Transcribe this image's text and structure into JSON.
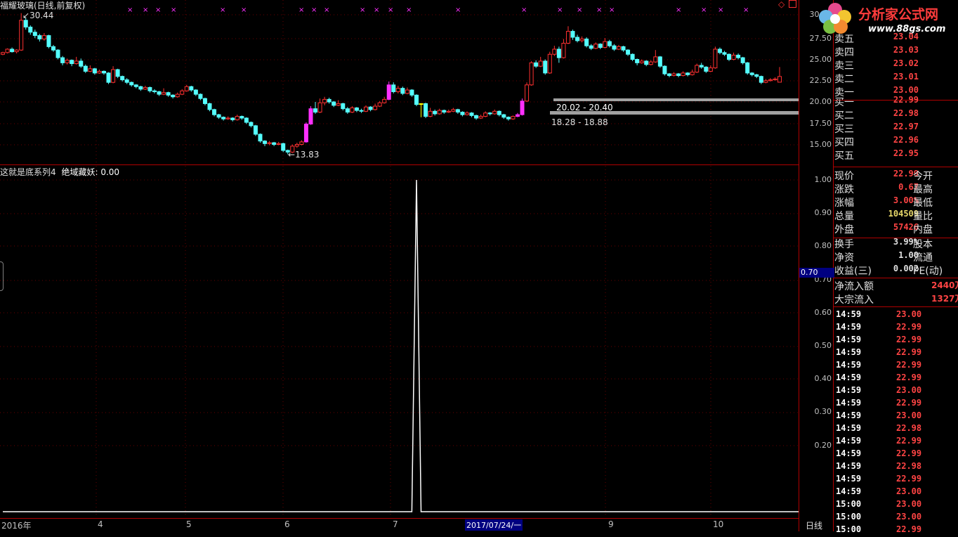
{
  "chart_title": "福耀玻璃(日线,前复权)",
  "indicator_title": "这就是底系列4",
  "indicator_name": "绝域藏妖",
  "indicator_value": "0.00",
  "price_axis": [
    "30.00",
    "27.50",
    "25.00",
    "22.50",
    "20.00",
    "17.50",
    "15.00"
  ],
  "indicator_axis": [
    "1.00",
    "0.90",
    "0.80",
    "0.70",
    "0.60",
    "0.50",
    "0.40",
    "0.30",
    "0.20"
  ],
  "indicator_cursor_value": "0.70",
  "annotations": {
    "high": "30.44",
    "low": "13.83",
    "zone_upper": "20.02 - 20.40",
    "zone_lower": "18.28 - 18.88"
  },
  "date_labels": [
    "2016年",
    "4",
    "5",
    "6",
    "7",
    "9",
    "10"
  ],
  "cursor_date": "2017/07/24/一",
  "period_tab": "日线",
  "logo": {
    "name": "分析家公式网",
    "url": "www.88gs.com"
  },
  "order_book": {
    "asks": [
      {
        "label": "卖五",
        "price": "23.04"
      },
      {
        "label": "卖四",
        "price": "23.03"
      },
      {
        "label": "卖三",
        "price": "23.02"
      },
      {
        "label": "卖二",
        "price": "23.01"
      },
      {
        "label": "卖一",
        "price": "23.00"
      }
    ],
    "bids": [
      {
        "label": "买一",
        "price": "22.99"
      },
      {
        "label": "买二",
        "price": "22.98"
      },
      {
        "label": "买三",
        "price": "22.97"
      },
      {
        "label": "买四",
        "price": "22.96"
      },
      {
        "label": "买五",
        "price": "22.95"
      }
    ]
  },
  "quote": [
    {
      "k": "现价",
      "v": "22.99",
      "k2": "今开",
      "color": "#ff4444"
    },
    {
      "k": "涨跌",
      "v": "0.67",
      "k2": "最高",
      "color": "#ff4444"
    },
    {
      "k": "涨幅",
      "v": "3.00%",
      "k2": "最低",
      "color": "#ff4444"
    },
    {
      "k": "总量",
      "v": "104509",
      "k2": "量比",
      "color": "#e8d86a"
    },
    {
      "k": "外盘",
      "v": "57426",
      "k2": "内盘",
      "color": "#ff4444"
    }
  ],
  "quote2": [
    {
      "k": "换手",
      "v": "3.99%",
      "k2": "股本",
      "color": "#e0e0e0"
    },
    {
      "k": "净资",
      "v": "1.00",
      "k2": "流通",
      "color": "#e0e0e0"
    },
    {
      "k": "收益(三)",
      "v": "0.002",
      "k2": "PE(动)",
      "color": "#e0e0e0"
    }
  ],
  "flows": [
    {
      "k": "净流入额",
      "v": "2440万"
    },
    {
      "k": "大宗流入",
      "v": "1327万"
    }
  ],
  "ticks": [
    {
      "t": "14:59",
      "p": "23.00"
    },
    {
      "t": "14:59",
      "p": "22.99"
    },
    {
      "t": "14:59",
      "p": "22.99"
    },
    {
      "t": "14:59",
      "p": "22.99"
    },
    {
      "t": "14:59",
      "p": "22.99"
    },
    {
      "t": "14:59",
      "p": "22.99"
    },
    {
      "t": "14:59",
      "p": "23.00"
    },
    {
      "t": "14:59",
      "p": "22.99"
    },
    {
      "t": "14:59",
      "p": "23.00"
    },
    {
      "t": "14:59",
      "p": "22.98"
    },
    {
      "t": "14:59",
      "p": "22.99"
    },
    {
      "t": "14:59",
      "p": "22.99"
    },
    {
      "t": "14:59",
      "p": "22.98"
    },
    {
      "t": "14:59",
      "p": "22.99"
    },
    {
      "t": "14:59",
      "p": "23.00"
    },
    {
      "t": "15:00",
      "p": "23.00"
    },
    {
      "t": "15:00",
      "p": "23.00"
    },
    {
      "t": "15:00",
      "p": "22.99"
    }
  ],
  "colors": {
    "up": "#ff3030",
    "down": "#54ffff",
    "grid": "#8b0000",
    "special_up": "#ff30ff",
    "special_flat": "#ffff00"
  },
  "chart_data": {
    "type": "line",
    "series": [
      {
        "values": [
          0,
          0,
          0,
          0,
          0,
          0,
          0,
          0,
          0,
          0,
          0,
          0,
          0,
          0,
          0,
          0,
          0,
          0,
          0,
          0,
          0,
          0,
          0,
          0,
          0,
          0,
          0,
          0,
          0,
          0,
          0,
          0,
          0,
          0,
          0,
          0,
          0,
          0,
          0,
          0,
          0,
          0,
          0,
          0,
          0,
          0,
          0,
          0,
          0,
          0,
          0,
          0,
          0,
          0,
          0,
          0,
          0,
          0,
          0,
          0,
          0,
          0,
          0,
          0,
          0,
          0,
          0,
          0,
          0,
          0,
          0,
          0,
          0,
          0,
          0,
          0,
          0,
          0,
          0,
          0,
          0,
          0,
          0,
          0,
          0,
          0,
          0,
          0,
          0,
          0,
          1,
          0,
          0,
          0,
          0,
          0,
          0,
          0,
          0,
          0,
          0,
          0,
          0,
          0,
          0,
          0,
          0,
          0,
          0,
          0,
          0,
          0,
          0,
          0,
          0,
          0,
          0,
          0,
          0,
          0,
          0,
          0,
          0,
          0,
          0,
          0,
          0,
          0,
          0,
          0,
          0,
          0,
          0,
          0,
          0,
          0,
          0,
          0,
          0,
          0,
          0,
          0,
          0,
          0,
          0,
          0,
          0,
          0,
          0,
          0,
          0,
          0,
          0,
          0,
          0,
          0,
          0,
          0,
          0,
          0,
          0,
          0,
          0,
          0,
          0,
          0,
          0,
          0,
          0,
          0,
          0,
          0,
          0,
          0,
          0,
          0,
          0,
          0,
          0,
          0,
          0,
          0,
          0,
          0,
          0,
          0,
          0,
          0,
          0,
          0,
          0,
          0,
          0,
          0,
          0,
          0,
          0,
          0,
          0,
          0,
          0,
          0,
          0,
          0,
          0,
          0,
          0,
          0,
          0,
          0,
          0,
          0,
          0,
          0,
          0,
          0,
          0,
          0,
          0,
          0,
          0,
          0,
          0,
          0,
          0,
          0,
          0,
          0,
          0,
          0,
          0,
          0,
          0,
          0,
          0,
          0,
          0,
          0,
          0,
          0,
          0,
          0,
          0,
          0,
          0,
          0,
          0,
          0,
          0,
          0,
          0,
          0,
          0,
          0,
          0,
          0,
          0,
          0,
          0,
          0,
          0,
          0,
          0,
          0,
          0
        ]
      }
    ],
    "ylim": [
      0,
      1
    ],
    "ticks_y": [
      0.2,
      0.3,
      0.4,
      0.5,
      0.6,
      0.7,
      0.8,
      0.9,
      1.0
    ]
  },
  "candles": [
    [
      25.6,
      25.8,
      25.9,
      25.5
    ],
    [
      25.8,
      26.2,
      26.3,
      25.7
    ],
    [
      26.2,
      25.9,
      26.4,
      25.8
    ],
    [
      25.9,
      26.1,
      26.2,
      25.7
    ],
    [
      26.1,
      29.6,
      30.44,
      26.0
    ],
    [
      29.6,
      28.8,
      29.9,
      28.5
    ],
    [
      28.8,
      28.2,
      29.0,
      27.9
    ],
    [
      28.2,
      27.8,
      28.5,
      27.5
    ],
    [
      27.8,
      27.4,
      28.0,
      27.1
    ],
    [
      27.4,
      27.8,
      28.1,
      27.2
    ],
    [
      27.8,
      26.5,
      27.9,
      26.3
    ],
    [
      26.5,
      26.1,
      26.7,
      25.9
    ],
    [
      26.1,
      25.2,
      26.2,
      25.0
    ],
    [
      25.2,
      24.6,
      25.4,
      24.3
    ],
    [
      24.6,
      24.9,
      25.1,
      24.4
    ],
    [
      24.9,
      24.5,
      25.0,
      24.2
    ],
    [
      24.5,
      24.8,
      25.3,
      24.4
    ],
    [
      24.8,
      24.2,
      25.1,
      24.0
    ],
    [
      24.2,
      23.6,
      24.4,
      23.4
    ],
    [
      23.6,
      23.9,
      24.3,
      23.5
    ],
    [
      23.9,
      23.4,
      24.0,
      23.2
    ],
    [
      23.4,
      23.6,
      23.8,
      23.3
    ],
    [
      23.6,
      23.4,
      23.7,
      23.2
    ],
    [
      23.4,
      22.3,
      23.5,
      22.1
    ],
    [
      22.3,
      23.8,
      24.2,
      22.2
    ],
    [
      23.8,
      23.0,
      23.9,
      22.8
    ],
    [
      23.0,
      22.6,
      23.1,
      22.4
    ],
    [
      22.6,
      22.3,
      22.8,
      22.1
    ],
    [
      22.3,
      22.0,
      22.4,
      21.8
    ],
    [
      22.0,
      21.8,
      22.1,
      21.6
    ],
    [
      21.8,
      21.5,
      21.9,
      21.3
    ],
    [
      21.5,
      21.7,
      21.9,
      21.4
    ],
    [
      21.7,
      21.3,
      21.8,
      21.1
    ],
    [
      21.3,
      21.2,
      21.5,
      21.0
    ],
    [
      21.2,
      20.9,
      21.3,
      20.7
    ],
    [
      20.9,
      21.1,
      21.6,
      20.8
    ],
    [
      21.1,
      20.8,
      21.2,
      20.6
    ],
    [
      20.8,
      20.6,
      20.9,
      20.4
    ],
    [
      20.6,
      20.9,
      21.1,
      20.5
    ],
    [
      20.9,
      21.3,
      21.5,
      20.8
    ],
    [
      21.3,
      21.8,
      22.0,
      21.2
    ],
    [
      21.8,
      21.4,
      21.9,
      21.2
    ],
    [
      21.4,
      20.9,
      21.5,
      20.7
    ],
    [
      20.9,
      20.4,
      21.0,
      20.2
    ],
    [
      20.4,
      19.8,
      20.5,
      19.6
    ],
    [
      19.8,
      19.1,
      19.9,
      18.9
    ],
    [
      19.1,
      18.5,
      19.2,
      18.3
    ],
    [
      18.5,
      18.2,
      18.6,
      18.0
    ],
    [
      18.2,
      18.0,
      18.3,
      17.8
    ],
    [
      18.0,
      18.1,
      18.3,
      17.9
    ],
    [
      18.1,
      17.9,
      18.2,
      17.7
    ],
    [
      17.9,
      18.3,
      18.5,
      17.8
    ],
    [
      18.3,
      18.1,
      18.4,
      17.9
    ],
    [
      18.1,
      17.6,
      18.2,
      17.4
    ],
    [
      17.6,
      17.2,
      17.7,
      17.0
    ],
    [
      17.2,
      16.2,
      17.3,
      16.0
    ],
    [
      16.2,
      15.4,
      16.3,
      15.2
    ],
    [
      15.4,
      15.1,
      15.5,
      14.8
    ],
    [
      15.1,
      15.2,
      15.4,
      14.9
    ],
    [
      15.2,
      15.0,
      15.3,
      14.8
    ],
    [
      15.0,
      15.1,
      15.3,
      14.9
    ],
    [
      15.1,
      14.3,
      15.2,
      14.1
    ],
    [
      14.3,
      14.1,
      14.4,
      13.83
    ],
    [
      14.1,
      14.8,
      15.0,
      14.0
    ],
    [
      14.8,
      15.0,
      15.2,
      14.6
    ],
    [
      15.0,
      15.3,
      15.5,
      14.9
    ],
    [
      15.3,
      17.4,
      17.6,
      15.2
    ],
    [
      17.4,
      19.2,
      19.5,
      17.3
    ],
    [
      19.2,
      18.8,
      20.0,
      18.6
    ],
    [
      18.8,
      19.9,
      20.4,
      18.7
    ],
    [
      19.9,
      20.3,
      20.6,
      19.6
    ],
    [
      20.3,
      20.0,
      20.5,
      19.8
    ],
    [
      20.0,
      19.6,
      20.1,
      19.4
    ],
    [
      19.6,
      19.8,
      20.2,
      19.5
    ],
    [
      19.8,
      19.2,
      19.9,
      19.0
    ],
    [
      19.2,
      18.8,
      19.4,
      18.6
    ],
    [
      18.8,
      19.3,
      19.5,
      18.7
    ],
    [
      19.3,
      19.0,
      19.4,
      18.8
    ],
    [
      19.0,
      18.9,
      19.2,
      18.7
    ],
    [
      18.9,
      19.4,
      19.6,
      18.8
    ],
    [
      19.4,
      19.1,
      19.5,
      18.9
    ],
    [
      19.1,
      19.5,
      19.8,
      19.0
    ],
    [
      19.5,
      19.9,
      20.1,
      19.4
    ],
    [
      19.9,
      20.3,
      20.6,
      19.8
    ],
    [
      20.3,
      22.0,
      22.4,
      20.2
    ],
    [
      22.0,
      21.2,
      22.3,
      21.0
    ],
    [
      21.2,
      21.6,
      21.9,
      21.0
    ],
    [
      21.6,
      21.0,
      21.8,
      20.8
    ],
    [
      21.0,
      21.4,
      21.7,
      20.9
    ],
    [
      21.4,
      20.8,
      21.5,
      20.6
    ],
    [
      20.8,
      19.7,
      20.9,
      19.5
    ],
    [
      19.7,
      19.8,
      19.8,
      18.2
    ],
    [
      19.8,
      18.3,
      19.9,
      18.1
    ],
    [
      18.3,
      18.9,
      19.3,
      18.2
    ],
    [
      18.9,
      18.6,
      19.1,
      18.4
    ],
    [
      18.6,
      19.0,
      19.2,
      18.5
    ],
    [
      19.0,
      18.8,
      19.1,
      18.6
    ],
    [
      18.8,
      18.9,
      19.1,
      18.7
    ],
    [
      18.9,
      19.1,
      19.3,
      18.8
    ],
    [
      19.1,
      18.8,
      19.2,
      18.6
    ],
    [
      18.8,
      18.5,
      18.9,
      18.3
    ],
    [
      18.5,
      18.7,
      18.9,
      18.4
    ],
    [
      18.7,
      18.4,
      18.8,
      18.2
    ],
    [
      18.4,
      18.1,
      18.5,
      17.9
    ],
    [
      18.1,
      18.3,
      18.5,
      18.0
    ],
    [
      18.3,
      18.7,
      18.9,
      18.2
    ],
    [
      18.7,
      18.6,
      18.8,
      18.4
    ],
    [
      18.6,
      18.9,
      19.1,
      18.5
    ],
    [
      18.9,
      18.5,
      19.0,
      18.3
    ],
    [
      18.5,
      18.2,
      18.6,
      18.0
    ],
    [
      18.2,
      18.0,
      18.3,
      17.8
    ],
    [
      18.0,
      18.3,
      18.4,
      17.9
    ],
    [
      18.3,
      18.5,
      18.7,
      18.2
    ],
    [
      18.5,
      20.1,
      20.4,
      18.4
    ],
    [
      20.1,
      22.0,
      22.3,
      20.0
    ],
    [
      22.0,
      24.6,
      24.8,
      21.9
    ],
    [
      24.6,
      24.2,
      24.9,
      24.0
    ],
    [
      24.2,
      24.8,
      25.3,
      24.1
    ],
    [
      24.8,
      23.4,
      25.0,
      23.2
    ],
    [
      23.4,
      25.6,
      25.9,
      23.3
    ],
    [
      25.6,
      26.2,
      26.6,
      25.4
    ],
    [
      26.2,
      25.2,
      26.5,
      24.6
    ],
    [
      25.2,
      26.9,
      27.4,
      25.1
    ],
    [
      26.9,
      28.3,
      28.9,
      26.8
    ],
    [
      28.3,
      27.6,
      28.5,
      27.3
    ],
    [
      27.6,
      27.2,
      27.9,
      27.0
    ],
    [
      27.2,
      27.4,
      27.7,
      27.0
    ],
    [
      27.4,
      26.6,
      27.6,
      26.4
    ],
    [
      26.6,
      26.3,
      26.8,
      26.1
    ],
    [
      26.3,
      26.8,
      27.0,
      26.2
    ],
    [
      26.8,
      26.4,
      26.9,
      26.2
    ],
    [
      26.4,
      27.1,
      27.5,
      26.3
    ],
    [
      27.1,
      26.6,
      27.3,
      26.4
    ],
    [
      26.6,
      26.2,
      26.8,
      26.0
    ],
    [
      26.2,
      26.5,
      26.7,
      26.1
    ],
    [
      26.5,
      26.1,
      26.6,
      25.9
    ],
    [
      26.1,
      25.6,
      26.2,
      25.4
    ],
    [
      25.6,
      25.0,
      25.7,
      24.8
    ],
    [
      25.0,
      24.6,
      25.1,
      24.3
    ],
    [
      24.6,
      24.8,
      25.0,
      24.5
    ],
    [
      24.8,
      24.4,
      24.9,
      24.2
    ],
    [
      24.4,
      24.7,
      24.9,
      24.3
    ],
    [
      24.7,
      25.3,
      26.1,
      24.6
    ],
    [
      25.3,
      24.2,
      25.4,
      24.0
    ],
    [
      24.2,
      23.3,
      24.3,
      23.1
    ],
    [
      23.3,
      23.1,
      23.4,
      22.9
    ],
    [
      23.1,
      23.3,
      23.5,
      23.0
    ],
    [
      23.3,
      23.1,
      23.4,
      22.9
    ],
    [
      23.1,
      23.4,
      23.6,
      23.0
    ],
    [
      23.4,
      23.2,
      23.5,
      23.0
    ],
    [
      23.2,
      23.5,
      23.8,
      23.1
    ],
    [
      23.5,
      24.3,
      24.5,
      23.4
    ],
    [
      24.3,
      24.1,
      24.6,
      23.9
    ],
    [
      24.1,
      23.6,
      24.2,
      23.4
    ],
    [
      23.6,
      24.0,
      24.3,
      23.5
    ],
    [
      24.0,
      26.2,
      26.5,
      23.9
    ],
    [
      26.2,
      25.8,
      26.4,
      25.6
    ],
    [
      25.8,
      25.6,
      26.0,
      25.4
    ],
    [
      25.6,
      25.0,
      25.7,
      24.8
    ],
    [
      25.0,
      25.5,
      25.8,
      24.9
    ],
    [
      25.5,
      25.2,
      25.7,
      25.0
    ],
    [
      25.2,
      24.6,
      25.3,
      24.4
    ],
    [
      24.6,
      23.4,
      24.7,
      23.2
    ],
    [
      23.4,
      23.2,
      23.5,
      23.0
    ],
    [
      23.2,
      23.0,
      23.3,
      22.8
    ],
    [
      23.0,
      22.3,
      23.1,
      22.1
    ],
    [
      22.3,
      22.5,
      22.7,
      22.2
    ],
    [
      22.5,
      22.6,
      22.8,
      22.4
    ],
    [
      22.6,
      22.7,
      22.9,
      22.5
    ],
    [
      22.32,
      22.99,
      24.1,
      22.3
    ]
  ]
}
